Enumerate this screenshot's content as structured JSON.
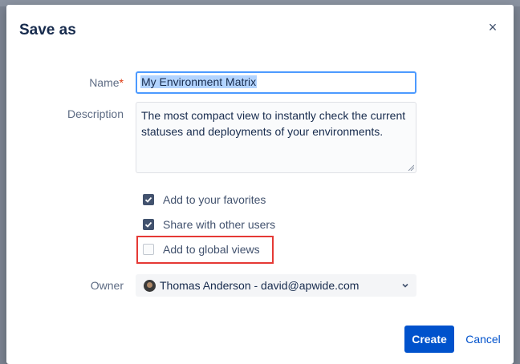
{
  "dialog": {
    "title": "Save as",
    "close_symbol": "×"
  },
  "form": {
    "name_label": "Name",
    "required_marker": "*",
    "name_value": "My Environment Matrix",
    "description_label": "Description",
    "description_value": "The most compact view to instantly check the current statuses and deployments of your environments.",
    "checkboxes": [
      {
        "label": "Add to your favorites",
        "checked": true
      },
      {
        "label": "Share with other users",
        "checked": true
      },
      {
        "label": "Add to global views",
        "checked": false
      }
    ],
    "owner_label": "Owner",
    "owner_value": "Thomas Anderson - david@apwide.com"
  },
  "actions": {
    "create_label": "Create",
    "cancel_label": "Cancel"
  },
  "colors": {
    "primary": "#0052cc",
    "highlight_border": "#e53935",
    "checkbox_checked": "#42526e",
    "focus_border": "#4c9aff"
  },
  "icons": {
    "close": "close-icon",
    "checkmark": "check-icon",
    "dropdown": "chevron-down-icon",
    "avatar": "avatar"
  }
}
